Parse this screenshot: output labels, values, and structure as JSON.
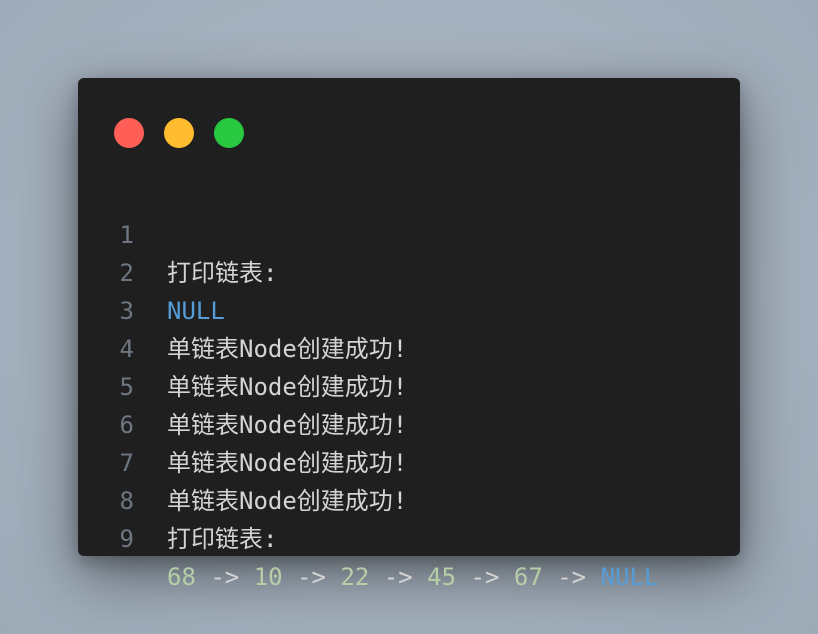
{
  "window": {
    "controls": [
      {
        "name": "close",
        "color": "#ff5f57"
      },
      {
        "name": "minimize",
        "color": "#febc2e"
      },
      {
        "name": "zoom",
        "color": "#28c840"
      }
    ]
  },
  "lines": [
    {
      "number": "1",
      "text": "打印链表:"
    },
    {
      "number": "2",
      "keyword": "NULL"
    },
    {
      "number": "3",
      "text": "单链表Node创建成功!"
    },
    {
      "number": "4",
      "text": "单链表Node创建成功!"
    },
    {
      "number": "5",
      "text": "单链表Node创建成功!"
    },
    {
      "number": "6",
      "text": "单链表Node创建成功!"
    },
    {
      "number": "7",
      "text": "单链表Node创建成功!"
    },
    {
      "number": "8",
      "text": "打印链表:"
    },
    {
      "number": "9",
      "list": [
        "68",
        "10",
        "22",
        "45",
        "67"
      ],
      "arrow": "->",
      "terminator": "NULL"
    }
  ],
  "colors": {
    "background": "#1f1f1f",
    "text": "#d4d4d4",
    "line_number": "#6e7681",
    "keyword": "#569cd6",
    "number": "#b5cea8"
  }
}
